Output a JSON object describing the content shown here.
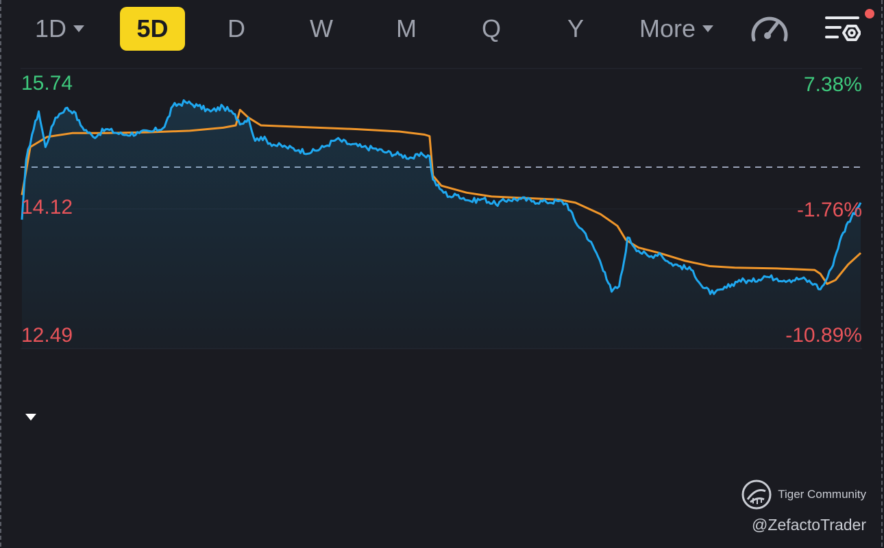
{
  "tabs": [
    {
      "label": "1D",
      "dropdown": true,
      "active": false
    },
    {
      "label": "5D",
      "dropdown": false,
      "active": true
    },
    {
      "label": "D",
      "dropdown": false,
      "active": false
    },
    {
      "label": "W",
      "dropdown": false,
      "active": false
    },
    {
      "label": "M",
      "dropdown": false,
      "active": false
    },
    {
      "label": "Q",
      "dropdown": false,
      "active": false
    },
    {
      "label": "Y",
      "dropdown": false,
      "active": false
    },
    {
      "label": "More",
      "dropdown": true,
      "active": false
    }
  ],
  "icons": {
    "gauge": "speedometer-icon",
    "settings": "chart-settings-icon",
    "notification": "notification-dot"
  },
  "colors": {
    "accent": "#f7d51e",
    "price_line": "#1fa8f0",
    "avg_line": "#f0962a",
    "positive": "#3ec97d",
    "negative": "#e8545a",
    "background": "#1a1b21"
  },
  "chart_data": {
    "type": "line",
    "title": "",
    "xlabel": "",
    "ylabel": "",
    "ylim": [
      12.49,
      15.74
    ],
    "y_pct_range": [
      "7.38%",
      "-10.89%"
    ],
    "reference_price": 14.66,
    "tick_labels": {
      "left_top": "15.74",
      "left_mid": "14.12",
      "left_bottom": "12.49",
      "right_top": "7.38%",
      "right_mid": "-1.76%",
      "right_bottom": "-10.89%"
    },
    "x_days": 5,
    "price_keypoints": [
      [
        0.0,
        13.98
      ],
      [
        0.005,
        14.75
      ],
      [
        0.012,
        15.08
      ],
      [
        0.02,
        15.38
      ],
      [
        0.028,
        14.92
      ],
      [
        0.04,
        15.3
      ],
      [
        0.052,
        15.42
      ],
      [
        0.062,
        15.38
      ],
      [
        0.07,
        15.2
      ],
      [
        0.085,
        15.05
      ],
      [
        0.1,
        15.15
      ],
      [
        0.12,
        15.08
      ],
      [
        0.14,
        15.1
      ],
      [
        0.155,
        15.12
      ],
      [
        0.17,
        15.18
      ],
      [
        0.18,
        15.45
      ],
      [
        0.195,
        15.5
      ],
      [
        0.21,
        15.45
      ],
      [
        0.225,
        15.38
      ],
      [
        0.24,
        15.44
      ],
      [
        0.252,
        15.35
      ],
      [
        0.262,
        15.22
      ],
      [
        0.27,
        15.3
      ],
      [
        0.278,
        15.0
      ],
      [
        0.285,
        15.05
      ],
      [
        0.3,
        14.95
      ],
      [
        0.315,
        14.92
      ],
      [
        0.33,
        14.88
      ],
      [
        0.345,
        14.85
      ],
      [
        0.36,
        14.92
      ],
      [
        0.375,
        15.02
      ],
      [
        0.39,
        14.96
      ],
      [
        0.405,
        14.92
      ],
      [
        0.42,
        14.9
      ],
      [
        0.435,
        14.85
      ],
      [
        0.45,
        14.82
      ],
      [
        0.465,
        14.78
      ],
      [
        0.478,
        14.82
      ],
      [
        0.486,
        14.8
      ],
      [
        0.49,
        14.5
      ],
      [
        0.498,
        14.38
      ],
      [
        0.51,
        14.28
      ],
      [
        0.52,
        14.3
      ],
      [
        0.535,
        14.22
      ],
      [
        0.55,
        14.25
      ],
      [
        0.565,
        14.18
      ],
      [
        0.58,
        14.24
      ],
      [
        0.595,
        14.25
      ],
      [
        0.61,
        14.22
      ],
      [
        0.625,
        14.21
      ],
      [
        0.64,
        14.22
      ],
      [
        0.65,
        14.18
      ],
      [
        0.66,
        13.95
      ],
      [
        0.672,
        13.8
      ],
      [
        0.685,
        13.55
      ],
      [
        0.695,
        13.3
      ],
      [
        0.703,
        13.05
      ],
      [
        0.712,
        13.12
      ],
      [
        0.718,
        13.45
      ],
      [
        0.722,
        13.75
      ],
      [
        0.735,
        13.58
      ],
      [
        0.748,
        13.5
      ],
      [
        0.76,
        13.55
      ],
      [
        0.772,
        13.42
      ],
      [
        0.785,
        13.38
      ],
      [
        0.8,
        13.32
      ],
      [
        0.812,
        13.1
      ],
      [
        0.825,
        13.02
      ],
      [
        0.84,
        13.1
      ],
      [
        0.855,
        13.2
      ],
      [
        0.87,
        13.18
      ],
      [
        0.885,
        13.25
      ],
      [
        0.9,
        13.22
      ],
      [
        0.915,
        13.2
      ],
      [
        0.93,
        13.22
      ],
      [
        0.945,
        13.15
      ],
      [
        0.952,
        13.08
      ],
      [
        0.958,
        13.18
      ],
      [
        0.965,
        13.35
      ],
      [
        0.975,
        13.7
      ],
      [
        0.985,
        13.95
      ],
      [
        0.995,
        14.12
      ],
      [
        1.0,
        14.2
      ]
    ],
    "avg_keypoints": [
      [
        0.0,
        14.3
      ],
      [
        0.01,
        14.92
      ],
      [
        0.03,
        15.05
      ],
      [
        0.06,
        15.1
      ],
      [
        0.1,
        15.1
      ],
      [
        0.15,
        15.11
      ],
      [
        0.2,
        15.13
      ],
      [
        0.24,
        15.17
      ],
      [
        0.255,
        15.2
      ],
      [
        0.26,
        15.4
      ],
      [
        0.27,
        15.3
      ],
      [
        0.285,
        15.2
      ],
      [
        0.33,
        15.18
      ],
      [
        0.4,
        15.15
      ],
      [
        0.45,
        15.12
      ],
      [
        0.48,
        15.08
      ],
      [
        0.486,
        15.06
      ],
      [
        0.49,
        14.55
      ],
      [
        0.5,
        14.42
      ],
      [
        0.53,
        14.33
      ],
      [
        0.56,
        14.28
      ],
      [
        0.6,
        14.26
      ],
      [
        0.64,
        14.24
      ],
      [
        0.66,
        14.2
      ],
      [
        0.69,
        14.05
      ],
      [
        0.71,
        13.9
      ],
      [
        0.72,
        13.72
      ],
      [
        0.735,
        13.62
      ],
      [
        0.76,
        13.55
      ],
      [
        0.79,
        13.45
      ],
      [
        0.82,
        13.38
      ],
      [
        0.85,
        13.36
      ],
      [
        0.9,
        13.35
      ],
      [
        0.945,
        13.33
      ],
      [
        0.952,
        13.28
      ],
      [
        0.96,
        13.15
      ],
      [
        0.97,
        13.2
      ],
      [
        0.985,
        13.4
      ],
      [
        1.0,
        13.55
      ]
    ],
    "series": [
      {
        "values": "price_keypoints",
        "color": "#1fa8f0"
      },
      {
        "values": "avg_keypoints",
        "color": "#f0962a"
      }
    ],
    "grid": false,
    "reference_line": "dashed"
  },
  "watermark": {
    "brand": "Tiger Community",
    "user": "@ZefactoTrader"
  }
}
